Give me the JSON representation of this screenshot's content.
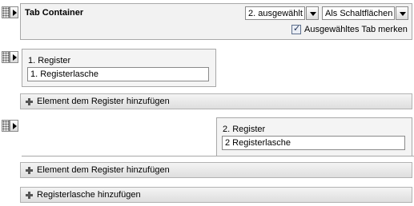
{
  "header": {
    "title": "Tab Container",
    "selected_option": "2. ausgewählt",
    "mode_option": "Als Schaltflächen",
    "remember_label": "Ausgewähltes Tab merken",
    "remember_checked": true
  },
  "registers": [
    {
      "label": "1. Register",
      "tab_value": "1. Registerlasche",
      "add_label": "Element dem Register hinzufügen"
    },
    {
      "label": "2. Register",
      "tab_value": "2 Registerlasche",
      "add_label": "Element dem Register hinzufügen"
    }
  ],
  "footer": {
    "add_tab_label": "Registerlasche hinzufügen"
  }
}
